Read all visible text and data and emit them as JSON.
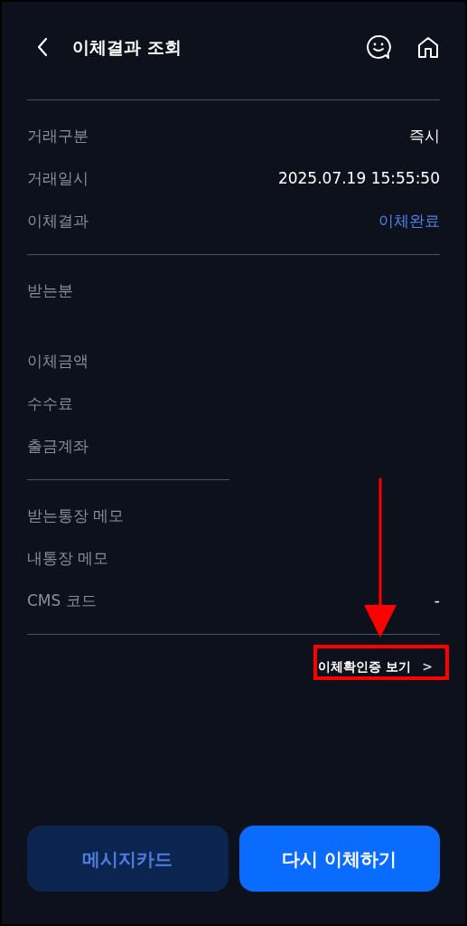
{
  "header": {
    "title": "이체결과 조회"
  },
  "sections": [
    {
      "full_divider": true,
      "rows": [
        {
          "label": "거래구분",
          "value": "즉시",
          "highlight": false
        },
        {
          "label": "거래일시",
          "value": "2025.07.19 15:55:50",
          "highlight": false
        },
        {
          "label": "이체결과",
          "value": "이체완료",
          "highlight": true
        }
      ]
    },
    {
      "full_divider": false,
      "rows": [
        {
          "label": "받는분",
          "gap_after": true
        },
        {
          "label": "이체금액"
        },
        {
          "label": "수수료"
        },
        {
          "label": "출금계좌"
        }
      ]
    },
    {
      "full_divider": true,
      "rows": [
        {
          "label": "받는통장 메모"
        },
        {
          "label": "내통장 메모"
        },
        {
          "label": "CMS 코드",
          "value": "-",
          "highlight": false
        }
      ]
    }
  ],
  "link": {
    "label": "이체확인증 보기",
    "chevron": ">"
  },
  "buttons": [
    {
      "label": "메시지카드",
      "kind": "secondary"
    },
    {
      "label": "다시 이체하기",
      "kind": "primary"
    }
  ]
}
